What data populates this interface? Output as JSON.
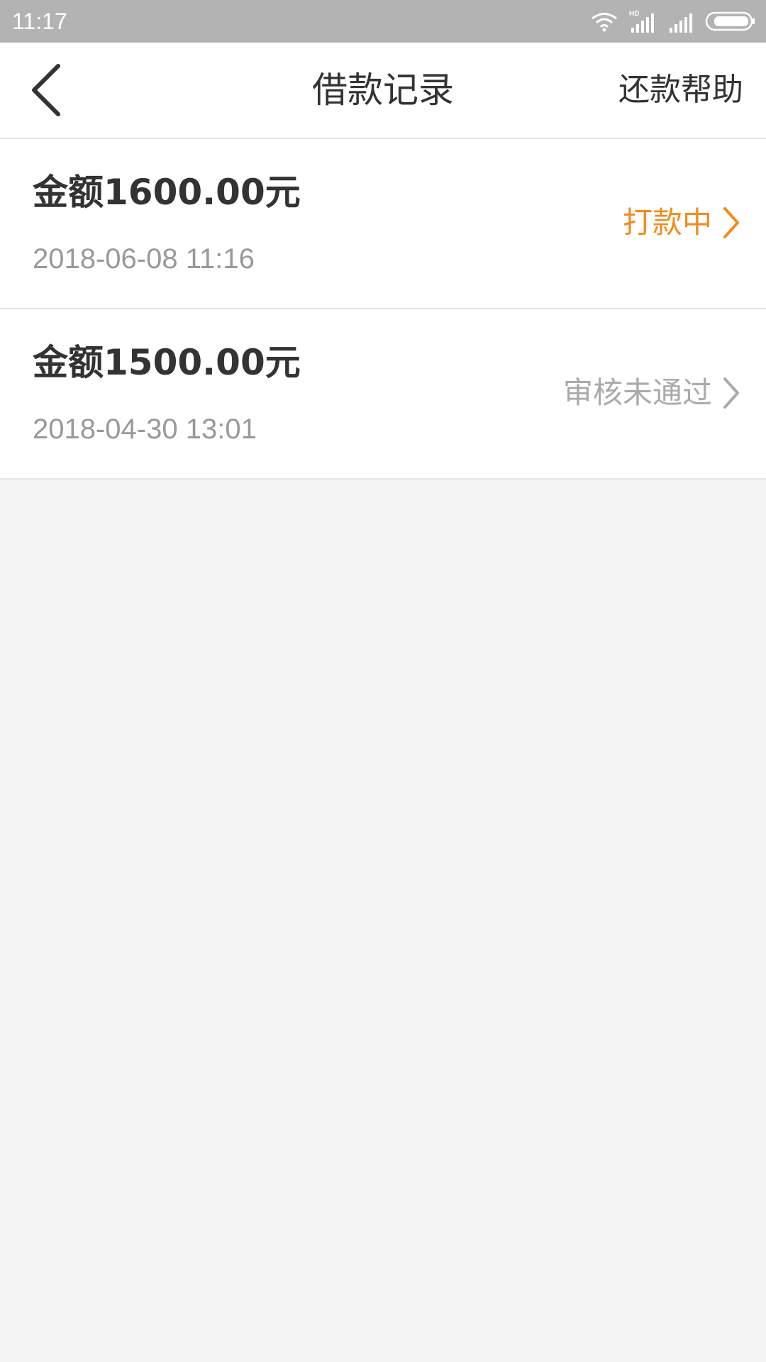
{
  "status_bar": {
    "time": "11:17",
    "network_label": "HD",
    "icons": [
      "wifi-icon",
      "signal-hd-icon",
      "signal-icon",
      "battery-icon"
    ]
  },
  "nav": {
    "back_icon": "chevron-left-icon",
    "title": "借款记录",
    "help_label": "还款帮助"
  },
  "records": [
    {
      "amount": "金额1600.00元",
      "datetime": "2018-06-08 11:16",
      "status": "打款中",
      "status_color": "#f08c1e"
    },
    {
      "amount": "金额1500.00元",
      "datetime": "2018-04-30 13:01",
      "status": "审核未通过",
      "status_color": "#aaaaaa"
    }
  ],
  "colors": {
    "status_bar": "#b3b3b3",
    "background": "#f3f3f3",
    "primary_text": "#333333",
    "secondary_text": "#999999",
    "accent_orange": "#f08c1e"
  }
}
